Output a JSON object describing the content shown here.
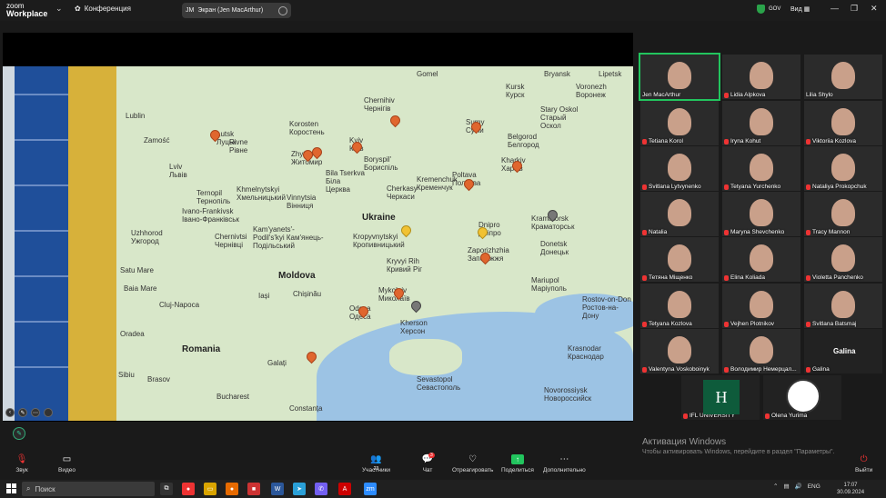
{
  "app": {
    "logo_line1": "zoom",
    "logo_line2": "Workplace",
    "meeting_label": "Конференция"
  },
  "screen_share": {
    "initials": "JM",
    "label": "Экран (Jen MacArthur)"
  },
  "security": {
    "gov_label": "GOV",
    "view_label": "Вид"
  },
  "map": {
    "labels": [
      {
        "text": "Lublin"
      },
      {
        "text": "Zamość"
      },
      {
        "text": "Lutsk Луцьк"
      },
      {
        "text": "Rivne Рівне"
      },
      {
        "text": "Korosten Коростень"
      },
      {
        "text": "Chernihiv Чернігів"
      },
      {
        "text": "Sumy Суми"
      },
      {
        "text": "Kursk Курск"
      },
      {
        "text": "Voronezh Воронеж"
      },
      {
        "text": "Stary Oskol Старый Оскол"
      },
      {
        "text": "Belgorod Белгород"
      },
      {
        "text": "Kyiv Київ"
      },
      {
        "text": "Zhytomyr Житомир"
      },
      {
        "text": "Boryspil' Бориспіль"
      },
      {
        "text": "Bila Tserkva Біла Церква"
      },
      {
        "text": "Lviv Львів"
      },
      {
        "text": "Ternopil Тернопіль"
      },
      {
        "text": "Khmelnytskyi Хмельницький"
      },
      {
        "text": "Vinnytsia Вінниця"
      },
      {
        "text": "Poltava Полтава"
      },
      {
        "text": "Kharkiv Харків"
      },
      {
        "text": "Cherkasy Черкаси"
      },
      {
        "text": "Kremenchuk Кременчук"
      },
      {
        "text": "Ivano-Frankivsk Івано-Франківськ"
      },
      {
        "text": "Ukraine"
      },
      {
        "text": "Kropyvnytskyi Кропивницький"
      },
      {
        "text": "Dnipro Дніпро"
      },
      {
        "text": "Kramatorsk Краматорськ"
      },
      {
        "text": "Chernivtsi Чернівці"
      },
      {
        "text": "Kam'yanets'-Podil's'kyi Кам'янець-Подільський"
      },
      {
        "text": "Uzhhorod Ужгород"
      },
      {
        "text": "Donetsk Донецьк"
      },
      {
        "text": "Zaporizhzhia Запоріжжя"
      },
      {
        "text": "Kryvyi Rih Кривий Ріг"
      },
      {
        "text": "Moldova"
      },
      {
        "text": "Mariupol Маріуполь"
      },
      {
        "text": "Iași"
      },
      {
        "text": "Chișinău"
      },
      {
        "text": "Mykolaiv Миколаїв"
      },
      {
        "text": "Rostov-on-Don Ростов-на-Дону"
      },
      {
        "text": "Cluj-Napoca"
      },
      {
        "text": "Odesa Одеса"
      },
      {
        "text": "Kherson Херсон"
      },
      {
        "text": "Romania"
      },
      {
        "text": "Krasnodar Краснодар"
      },
      {
        "text": "Sevastopol Севастополь"
      },
      {
        "text": "Galați"
      },
      {
        "text": "Bucharest"
      },
      {
        "text": "Constanța"
      },
      {
        "text": "Novorossiysk Новороссийск"
      },
      {
        "text": "Sibiu"
      },
      {
        "text": "Brasov"
      },
      {
        "text": "Satu Mare"
      },
      {
        "text": "Oradea"
      },
      {
        "text": "Baia Mare"
      },
      {
        "text": "Gomel"
      },
      {
        "text": "Bryansk"
      },
      {
        "text": "Lipetsk"
      }
    ]
  },
  "participants": [
    {
      "name": "Jen MacArthur",
      "muted": false
    },
    {
      "name": "Lidia Alpkova",
      "muted": true
    },
    {
      "name": "Lilia Shylo",
      "muted": false
    },
    {
      "name": "Tetiana Korol",
      "muted": true
    },
    {
      "name": "Iryna Kohut",
      "muted": true
    },
    {
      "name": "Viktoriia Kozlova",
      "muted": true
    },
    {
      "name": "Svitlana Lytvynenko",
      "muted": true
    },
    {
      "name": "Tetyana Yurchenko",
      "muted": true
    },
    {
      "name": "Nataliya Prokopchuk",
      "muted": true
    },
    {
      "name": "Natalia",
      "muted": true
    },
    {
      "name": "Maryna Shevchenko",
      "muted": true
    },
    {
      "name": "Tracy Mannon",
      "muted": true
    },
    {
      "name": "Тетяна Міщенко",
      "muted": true
    },
    {
      "name": "Elina Koliada",
      "muted": true
    },
    {
      "name": "Violetta Panchenko",
      "muted": true
    },
    {
      "name": "Tetyana Kozlova",
      "muted": true
    },
    {
      "name": "Vejhen Plotnikov",
      "muted": true
    },
    {
      "name": "Svitlana Batsmaj",
      "muted": true
    },
    {
      "name": "Valentyna Voskoboinyk",
      "muted": true
    },
    {
      "name": "Володимир Немерцал...",
      "muted": true
    },
    {
      "name": "Galina",
      "muted": true
    },
    {
      "name": "IFL UNIVERSITY",
      "muted": true
    },
    {
      "name": "Olena Yurima",
      "muted": true
    }
  ],
  "galina_big": "Galina",
  "ifl_logo_letter": "H",
  "windows_activation": {
    "title": "Активация Windows",
    "subtitle": "Чтобы активировать Windows, перейдите в раздел \"Параметры\"."
  },
  "controls": {
    "audio": "Звук",
    "video": "Видео",
    "participants": "Участники",
    "participants_count": "23",
    "chat": "Чат",
    "chat_badge": "3",
    "react": "Отреагировать",
    "share": "Поделиться",
    "more": "Дополнительно",
    "leave": "Выйти"
  },
  "taskbar": {
    "search_placeholder": "Поиск",
    "lang": "ENG",
    "time": "17:07",
    "date": "30.09.2024"
  }
}
